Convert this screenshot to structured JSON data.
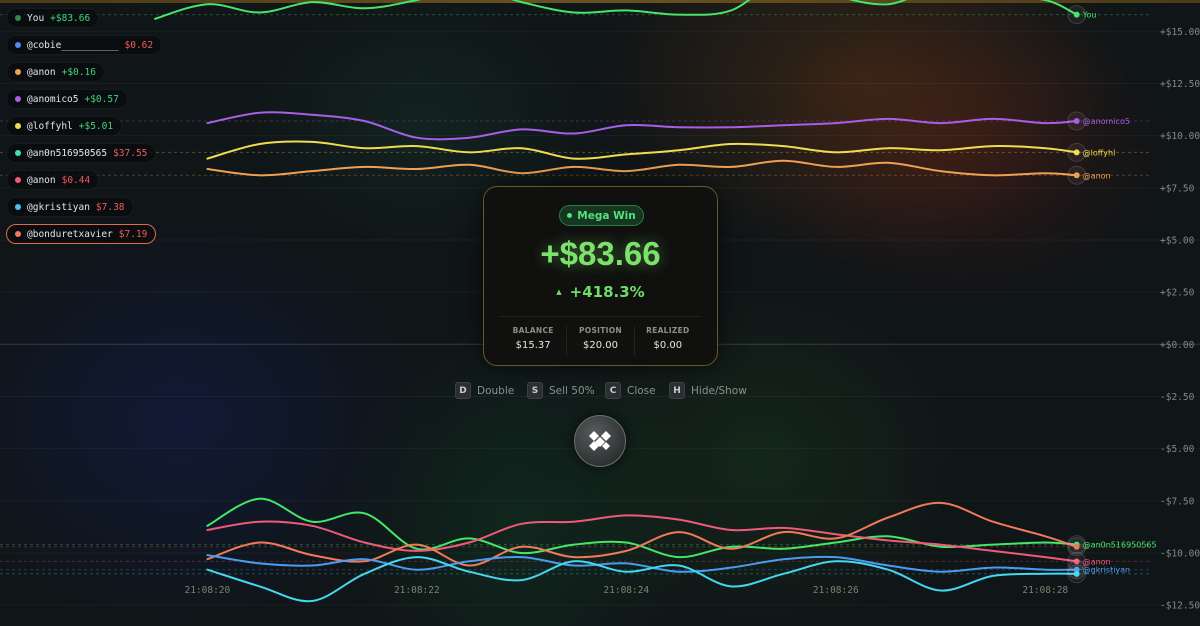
{
  "legend": [
    {
      "name": "You",
      "pnl": "+$83.66",
      "color": "#2e8a4a",
      "positive": true,
      "selected": false
    },
    {
      "name": "@cobie__________",
      "pnl": "$0.62",
      "color": "#4a8cf0",
      "positive": false,
      "selected": false
    },
    {
      "name": "@anon",
      "pnl": "+$0.16",
      "color": "#f0a050",
      "positive": true,
      "selected": false
    },
    {
      "name": "@anomico5",
      "pnl": "+$0.57",
      "color": "#a85ee8",
      "positive": true,
      "selected": false
    },
    {
      "name": "@loffyhl",
      "pnl": "+$5.01",
      "color": "#f0dc50",
      "positive": true,
      "selected": false
    },
    {
      "name": "@an0n516950565",
      "pnl": "$37.55",
      "color": "#45e0b0",
      "positive": false,
      "selected": false
    },
    {
      "name": "@anon",
      "pnl": "$0.44",
      "color": "#ef5a7a",
      "positive": false,
      "selected": false
    },
    {
      "name": "@gkristiyan",
      "pnl": "$7.38",
      "color": "#45c0f0",
      "positive": false,
      "selected": false
    },
    {
      "name": "@bonduretxavier",
      "pnl": "$7.19",
      "color": "#f07a5a",
      "positive": false,
      "selected": true
    }
  ],
  "card": {
    "badge": "Mega Win",
    "pnl": "+$83.66",
    "arrow": "▲",
    "pct": "+418.3%",
    "stats": [
      {
        "label": "BALANCE",
        "value": "$15.37"
      },
      {
        "label": "POSITION",
        "value": "$20.00"
      },
      {
        "label": "REALIZED",
        "value": "$0.00"
      }
    ]
  },
  "shortcuts": [
    {
      "key": "D",
      "label": "Double"
    },
    {
      "key": "S",
      "label": "Sell 50%"
    },
    {
      "key": "C",
      "label": "Close"
    },
    {
      "key": "H",
      "label": "Hide/Show"
    }
  ],
  "logo_icon": "diamond-logo-icon",
  "colors": {
    "accent_green": "#7ee06e",
    "card_border": "#6a5724",
    "selected_border": "#e06a4a"
  },
  "chart_data": {
    "type": "line",
    "y_ticks": [
      "+$15.00",
      "+$12.50",
      "+$10.00",
      "+$7.50",
      "+$5.00",
      "+$2.50",
      "+$0.00",
      "-$2.50",
      "-$5.00",
      "-$7.50",
      "-$10.00",
      "-$12.50"
    ],
    "x_ticks": [
      "21:08:20",
      "21:08:22",
      "21:08:24",
      "21:08:26",
      "21:08:28"
    ],
    "ylim": [
      -13.5,
      16.5
    ],
    "x_range": [
      19.5,
      29
    ],
    "series": [
      {
        "name": "You",
        "color": "#45e66a",
        "end_label": "You",
        "x": [
          19.5,
          20.0,
          20.5,
          21.0,
          21.5,
          22.0,
          22.5,
          23.0,
          23.5,
          24.0,
          24.5,
          25.0,
          25.5,
          26.0,
          26.5,
          27.0,
          27.5,
          28.0,
          28.3
        ],
        "y": [
          15.6,
          16.3,
          15.9,
          16.4,
          16.1,
          16.5,
          17.1,
          16.4,
          15.9,
          16.0,
          15.8,
          16.0,
          17.5,
          16.7,
          16.3,
          17.1,
          16.7,
          16.5,
          15.8
        ]
      },
      {
        "name": "@anomico5",
        "color": "#a85ee8",
        "end_label": "@anomico5",
        "x": [
          20.0,
          20.5,
          21.0,
          21.5,
          22.0,
          22.5,
          23.0,
          23.5,
          24.0,
          24.5,
          25.0,
          25.5,
          26.0,
          26.5,
          27.0,
          27.5,
          28.0,
          28.3
        ],
        "y": [
          10.6,
          11.1,
          11.0,
          10.7,
          9.9,
          9.9,
          10.3,
          10.1,
          10.5,
          10.4,
          10.4,
          10.5,
          10.6,
          10.8,
          10.6,
          10.8,
          10.6,
          10.7
        ]
      },
      {
        "name": "@loffyhl",
        "color": "#f0dc50",
        "end_label": "@loffyhl",
        "x": [
          20.0,
          20.5,
          21.0,
          21.5,
          22.0,
          22.5,
          23.0,
          23.5,
          24.0,
          24.5,
          25.0,
          25.5,
          26.0,
          26.5,
          27.0,
          27.5,
          28.0,
          28.3
        ],
        "y": [
          8.9,
          9.6,
          9.7,
          9.4,
          9.5,
          9.2,
          9.4,
          8.9,
          9.1,
          9.3,
          9.6,
          9.5,
          9.2,
          9.4,
          9.3,
          9.5,
          9.4,
          9.2
        ]
      },
      {
        "name": "@anon",
        "color": "#f0a050",
        "end_label": "@anon",
        "x": [
          20.0,
          20.5,
          21.0,
          21.5,
          22.0,
          22.5,
          23.0,
          23.5,
          24.0,
          24.5,
          25.0,
          25.5,
          26.0,
          26.5,
          27.0,
          27.5,
          28.0,
          28.3
        ],
        "y": [
          8.4,
          8.1,
          8.3,
          8.5,
          8.4,
          8.6,
          8.2,
          8.5,
          8.3,
          8.6,
          8.5,
          8.8,
          8.5,
          8.7,
          8.3,
          8.1,
          8.2,
          8.1
        ]
      },
      {
        "name": "@an0n516950565",
        "color": "#45e66a",
        "end_label": "@an0n516950565",
        "x": [
          20.0,
          20.5,
          21.0,
          21.5,
          22.0,
          22.5,
          23.0,
          23.5,
          24.0,
          24.5,
          25.0,
          25.5,
          26.0,
          26.5,
          27.0,
          27.5,
          28.0,
          28.3
        ],
        "y": [
          -8.7,
          -7.4,
          -8.5,
          -8.1,
          -9.8,
          -9.3,
          -10.0,
          -9.6,
          -9.5,
          -10.2,
          -9.7,
          -9.8,
          -9.5,
          -9.2,
          -9.7,
          -9.6,
          -9.5,
          -9.6
        ]
      },
      {
        "name": "@anon",
        "color": "#ef5a7a",
        "end_label": "@anon",
        "x": [
          20.0,
          20.5,
          21.0,
          21.5,
          22.0,
          22.5,
          23.0,
          23.5,
          24.0,
          24.5,
          25.0,
          25.5,
          26.0,
          26.5,
          27.0,
          27.5,
          28.0,
          28.3
        ],
        "y": [
          -8.9,
          -8.5,
          -8.7,
          -9.5,
          -9.9,
          -9.5,
          -8.6,
          -8.5,
          -8.2,
          -8.4,
          -8.9,
          -8.8,
          -9.1,
          -9.4,
          -9.6,
          -9.9,
          -10.2,
          -10.4
        ]
      },
      {
        "name": "@bonduretxavier",
        "color": "#f07a5a",
        "end_label": "",
        "x": [
          20.0,
          20.5,
          21.0,
          21.5,
          22.0,
          22.5,
          23.0,
          23.5,
          24.0,
          24.5,
          25.0,
          25.5,
          26.0,
          26.5,
          27.0,
          27.5,
          28.0,
          28.3
        ],
        "y": [
          -10.3,
          -9.5,
          -10.1,
          -10.4,
          -9.6,
          -10.6,
          -9.7,
          -10.2,
          -9.9,
          -9.0,
          -9.8,
          -9.0,
          -9.3,
          -8.3,
          -7.6,
          -8.5,
          -9.2,
          -9.7
        ]
      },
      {
        "name": "@gkristiyan",
        "color": "#4a9cf0",
        "end_label": "@gkristiyan",
        "x": [
          20.0,
          20.5,
          21.0,
          21.5,
          22.0,
          22.5,
          23.0,
          23.5,
          24.0,
          24.5,
          25.0,
          25.5,
          26.0,
          26.5,
          27.0,
          27.5,
          28.0,
          28.3
        ],
        "y": [
          -10.1,
          -10.5,
          -10.6,
          -10.3,
          -10.8,
          -10.4,
          -10.2,
          -10.6,
          -10.5,
          -10.9,
          -10.7,
          -10.3,
          -10.2,
          -10.6,
          -10.9,
          -10.7,
          -10.8,
          -10.8
        ]
      },
      {
        "name": "@cobie__________",
        "color": "#45d6f0",
        "end_label": "",
        "x": [
          20.0,
          20.5,
          21.0,
          21.5,
          22.0,
          22.5,
          23.0,
          23.5,
          24.0,
          24.5,
          25.0,
          25.5,
          26.0,
          26.5,
          27.0,
          27.5,
          28.0,
          28.3
        ],
        "y": [
          -10.8,
          -11.6,
          -12.3,
          -11.0,
          -10.2,
          -10.9,
          -11.3,
          -10.4,
          -10.9,
          -10.6,
          -11.6,
          -11.0,
          -10.4,
          -10.8,
          -11.8,
          -11.1,
          -11.0,
          -11.0
        ]
      }
    ]
  }
}
